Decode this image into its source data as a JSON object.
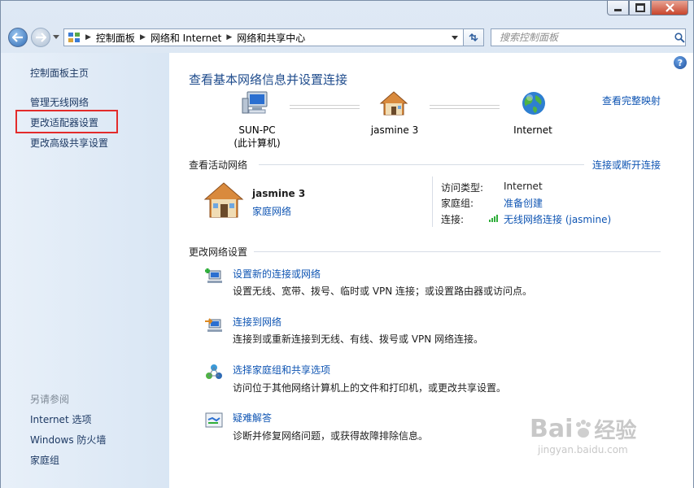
{
  "address_bar": {
    "crumbs": [
      "控制面板",
      "网络和 Internet",
      "网络和共享中心"
    ]
  },
  "search": {
    "placeholder": "搜索控制面板"
  },
  "sidebar": {
    "items": [
      {
        "label": "控制面板主页"
      },
      {
        "label": "管理无线网络"
      },
      {
        "label": "更改适配器设置"
      },
      {
        "label": "更改高级共享设置"
      }
    ],
    "see_also_label": "另请参阅",
    "see_also": [
      {
        "label": "Internet 选项"
      },
      {
        "label": "Windows 防火墙"
      },
      {
        "label": "家庭组"
      }
    ]
  },
  "main": {
    "title": "查看基本网络信息并设置连接",
    "view_full_map": "查看完整映射",
    "map_nodes": [
      {
        "name": "SUN-PC",
        "sub": "(此计算机)"
      },
      {
        "name": "jasmine  3"
      },
      {
        "name": "Internet"
      }
    ],
    "active_networks_title": "查看活动网络",
    "connect_disconnect": "连接或断开连接",
    "network": {
      "name": "jasmine  3",
      "type_link": "家庭网络",
      "access_type_label": "访问类型:",
      "access_type_value": "Internet",
      "homegroup_label": "家庭组:",
      "homegroup_value": "准备创建",
      "connection_label": "连接:",
      "connection_value": "无线网络连接 (jasmine)"
    },
    "change_settings_title": "更改网络设置",
    "tasks": [
      {
        "title": "设置新的连接或网络",
        "desc": "设置无线、宽带、拨号、临时或 VPN 连接；或设置路由器或访问点。"
      },
      {
        "title": "连接到网络",
        "desc": "连接到或重新连接到无线、有线、拨号或 VPN 网络连接。"
      },
      {
        "title": "选择家庭组和共享选项",
        "desc": "访问位于其他网络计算机上的文件和打印机，或更改共享设置。"
      },
      {
        "title": "疑难解答",
        "desc": "诊断并修复网络问题，或获得故障排除信息。"
      }
    ]
  },
  "watermark": {
    "brand": "Bai",
    "brand2": "经验",
    "url": "jingyan.baidu.com"
  }
}
